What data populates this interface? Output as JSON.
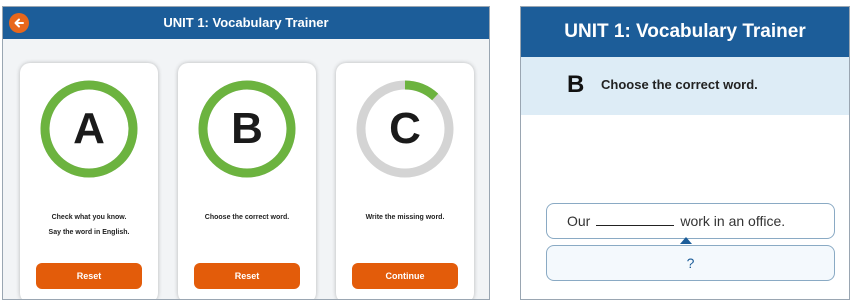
{
  "left_screen": {
    "title": "UNIT 1: Vocabulary Trainer",
    "back_icon": "arrow-left-icon",
    "colors": {
      "header": "#1c5d99",
      "accent": "#e35c0a",
      "ring_complete": "#6cb33f",
      "ring_empty": "#d4d4d4"
    },
    "cards": [
      {
        "letter": "A",
        "progress": 1.0,
        "desc": [
          "Check what you know.",
          "Say the word in English."
        ],
        "button": "Reset"
      },
      {
        "letter": "B",
        "progress": 1.0,
        "desc": [
          "Choose the correct word."
        ],
        "button": "Reset"
      },
      {
        "letter": "C",
        "progress": 0.12,
        "desc": [
          "Write the missing word."
        ],
        "button": "Continue"
      }
    ]
  },
  "right_screen": {
    "title": "UNIT 1: Vocabulary Trainer",
    "instruction": {
      "letter": "B",
      "text": "Choose the correct word."
    },
    "sentence": {
      "before": "Our",
      "after": "work in an office."
    },
    "answer": "?"
  }
}
